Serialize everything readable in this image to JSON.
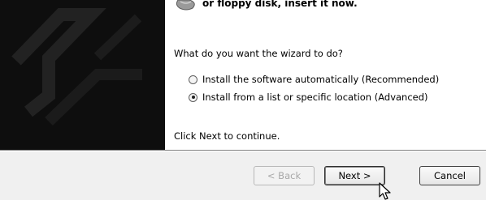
{
  "header": {
    "instruction_partial": "or floppy disk, insert it now."
  },
  "question": "What do you want the wizard to do?",
  "options": [
    {
      "label": "Install the software automatically (Recommended)",
      "selected": false
    },
    {
      "label": "Install from a list or specific location (Advanced)",
      "selected": true
    }
  ],
  "footer_text": "Click Next to continue.",
  "buttons": {
    "back": "< Back",
    "next": "Next >",
    "cancel": "Cancel"
  },
  "icons": {
    "disk": "cd-disk-icon",
    "cursor": "mouse-pointer-icon"
  }
}
